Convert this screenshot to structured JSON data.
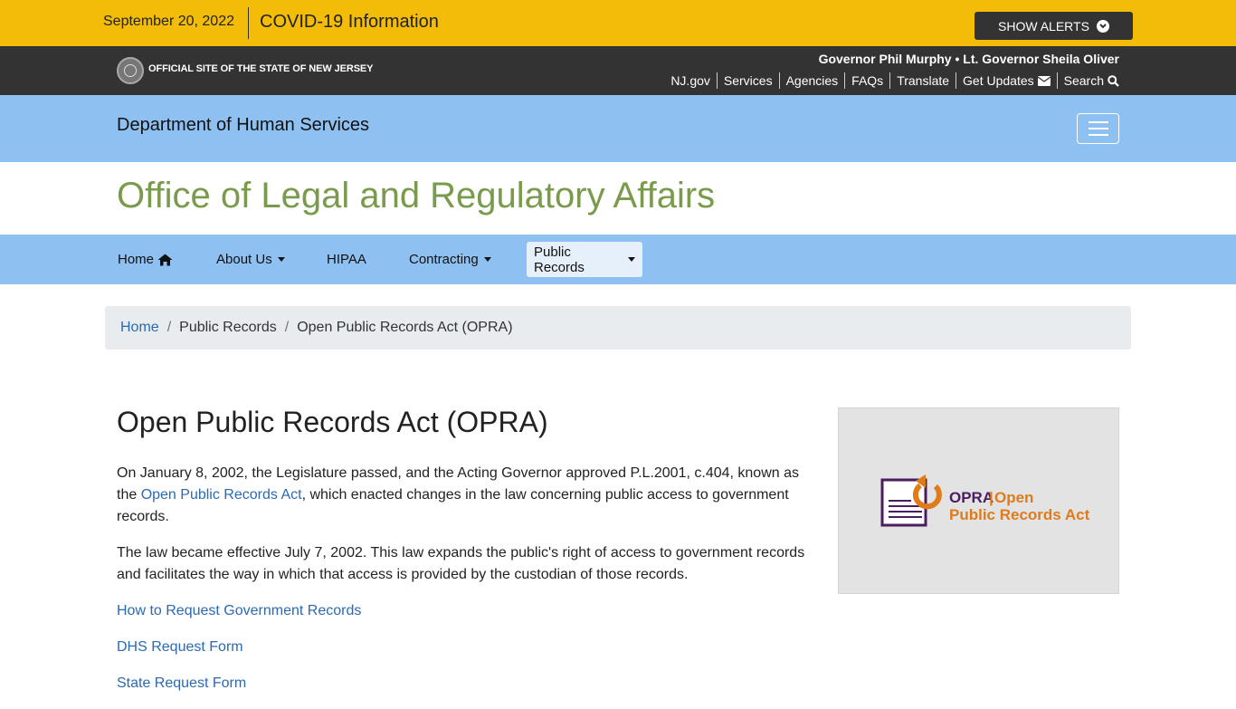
{
  "alert_bar": {
    "date": "September 20, 2022",
    "covid_label": "COVID-19 Information",
    "show_alerts_label": "SHOW ALERTS",
    "background": "#f2bc08"
  },
  "state_bar": {
    "official_label": "OFFICIAL SITE OF THE STATE OF NEW JERSEY",
    "governor_line": "Governor Phil Murphy • Lt. Governor Sheila Oliver",
    "links": [
      "NJ.gov",
      "Services",
      "Agencies",
      "FAQs",
      "Translate",
      "Get Updates",
      "Search"
    ],
    "background": "#333333"
  },
  "dept_bar": {
    "name": "Department of Human Services",
    "background": "#8ec1f2"
  },
  "office": {
    "title": "Office of Legal and Regulatory Affairs",
    "color": "#7a9a4c"
  },
  "nav": {
    "items": [
      {
        "label": "Home",
        "icon": "home-icon",
        "dropdown": false,
        "active": false
      },
      {
        "label": "About Us",
        "dropdown": true,
        "active": false
      },
      {
        "label": "HIPAA",
        "dropdown": false,
        "active": false
      },
      {
        "label": "Contracting",
        "dropdown": true,
        "active": false
      },
      {
        "label": "Public Records",
        "dropdown": true,
        "active": true
      }
    ]
  },
  "breadcrumb": {
    "home": "Home",
    "level1": "Public Records",
    "current": "Open Public Records Act (OPRA)"
  },
  "main": {
    "title": "Open Public Records Act (OPRA)",
    "p1_before": "On January 8, 2002, the Legislature passed, and the Acting Governor approved P.L.2001, c.404, known as the ",
    "p1_link": "Open Public Records Act",
    "p1_after": ", which enacted changes in the law concerning public access to government records.",
    "p2": "The law became effective July 7, 2002. This law expands the public's right of access to government records and facilitates the way in which that access is provided by the custodian of those records.",
    "links": [
      "How to Request Government Records",
      "DHS Request Form",
      "State Request Form"
    ],
    "link_color": "#2a6ab3"
  },
  "opra_logo": {
    "line1_bold": "OPRA",
    "line1_sep": "|",
    "line1_rest": "Open",
    "line2": "Public Records Act",
    "colors": {
      "purple": "#4a1d5e",
      "orange": "#e07b1a"
    }
  }
}
